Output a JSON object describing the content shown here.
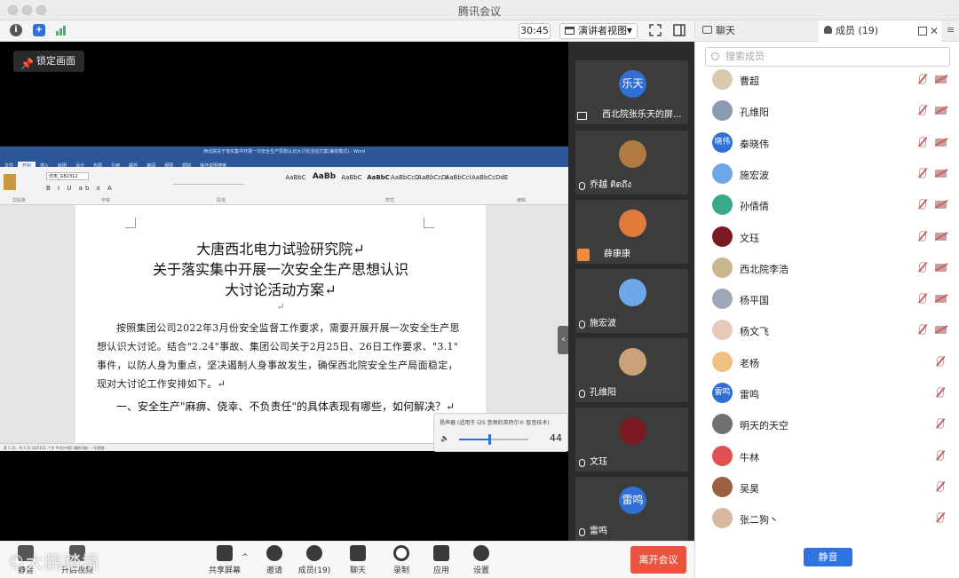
{
  "window": {
    "title": "腾讯会议"
  },
  "toolbar": {
    "timer": "30:45",
    "view_label": "演讲者视图",
    "colors": {
      "info": "#555555",
      "shield": "#2f6fd6",
      "signal": "#3dbb5e"
    }
  },
  "stage": {
    "lock_label": "锁定画面",
    "word": {
      "title_bar": "西北院关于落实集中开展一次安全生产思想认识大讨论活动方案(兼容模式) - Word",
      "tabs": [
        "文件",
        "开始",
        "插入",
        "绘图",
        "设计",
        "布局",
        "引用",
        "邮件",
        "审阅",
        "视图",
        "帮助",
        "操作说明搜索"
      ],
      "font_name": "仿宋_GB2312",
      "styles": [
        "AaBbC",
        "AaBb",
        "AaBbC",
        "AaBbC",
        "AaBbCcD",
        "AaBbCcDi",
        "AaBbCcI",
        "AaBbCcDdE"
      ],
      "groups": [
        "剪贴板",
        "字体",
        "段落",
        "样式",
        "编辑"
      ],
      "title_lines": [
        "大唐西北电力试验研究院↵",
        "关于落实集中开展一次安全生产思想认识",
        "大讨论活动方案↵"
      ],
      "return_mark": "↵",
      "paragraph": "按照集团公司2022年3月份安全监督工作要求，需要开展开展一次安全生产思想认识大讨论。结合\"2.24\"事故、集团公司关于2月25日、26日工作要求、\"3.1\" 事件，以防人身为重点，坚决遏制人身事故发生，确保西北院安全生产局面稳定，现对大讨论工作安排如下。↵",
      "subheading": "一、安全生产\"麻痹、侥幸、不负责任\"的具体表现有哪些，如何解决？↵",
      "status": "第 1 页，共 5 页    10/2161 个字    中文(中国)    辅助功能: 一切就绪"
    },
    "volume": {
      "label": "扬声器 (适用于 I2S 音频的英特尔® 智音技术)",
      "value": "44",
      "level": 0.44
    }
  },
  "videos": [
    {
      "name": "西北院张乐天的屏...",
      "avatar_text": "乐天",
      "avatar_color": "#2f6fd6",
      "kind": "screen"
    },
    {
      "name": "乔越 ติดถึง",
      "avatar_text": "",
      "avatar_color": "#b07a40",
      "kind": "mic"
    },
    {
      "name": "薛康康",
      "avatar_text": "",
      "avatar_color": "#e07a3a",
      "kind": "org"
    },
    {
      "name": "施宏波",
      "avatar_text": "",
      "avatar_color": "#6fa8e8",
      "kind": "mic"
    },
    {
      "name": "孔维阳",
      "avatar_text": "",
      "avatar_color": "#c9a27a",
      "kind": "mic"
    },
    {
      "name": "文珏",
      "avatar_text": "",
      "avatar_color": "#7a1a22",
      "kind": "mic"
    },
    {
      "name": "雷鸣",
      "avatar_text": "雷鸣",
      "avatar_color": "#2f6fd6",
      "kind": "mic"
    }
  ],
  "bottombar": {
    "items": [
      {
        "label": "静音"
      },
      {
        "label": "开启视频"
      },
      {
        "label": "共享屏幕"
      },
      {
        "label": "邀请"
      },
      {
        "label": "成员(19)"
      },
      {
        "label": "聊天"
      },
      {
        "label": "录制"
      },
      {
        "label": "应用"
      },
      {
        "label": "设置"
      }
    ],
    "leave_label": "离开会议",
    "watermark": "©大鹏踏境"
  },
  "panel": {
    "tabs": [
      {
        "label": "聊天"
      },
      {
        "label": "成员 (19)"
      }
    ],
    "search_placeholder": "搜索成员",
    "members": [
      {
        "name": "曹超",
        "avatar_text": "",
        "color": "#d9c9b0",
        "cam": true
      },
      {
        "name": "孔维阳",
        "avatar_text": "",
        "color": "#8a9bb0",
        "cam": true
      },
      {
        "name": "秦晓伟",
        "avatar_text": "晓伟",
        "color": "#2f6fd6",
        "cam": true
      },
      {
        "name": "施宏波",
        "avatar_text": "",
        "color": "#6fa8e8",
        "cam": true
      },
      {
        "name": "孙倩倩",
        "avatar_text": "",
        "color": "#3aa88a",
        "cam": true
      },
      {
        "name": "文珏",
        "avatar_text": "",
        "color": "#7a1a22",
        "cam": true
      },
      {
        "name": "西北院李浩",
        "avatar_text": "",
        "color": "#c8b890",
        "cam": true
      },
      {
        "name": "杨平国",
        "avatar_text": "",
        "color": "#a0a8b8",
        "cam": true
      },
      {
        "name": "杨文飞",
        "avatar_text": "",
        "color": "#e8c8b8",
        "cam": true
      },
      {
        "name": "老杨",
        "avatar_text": "",
        "color": "#f0c080",
        "cam": false
      },
      {
        "name": "雷鸣",
        "avatar_text": "雷鸣",
        "color": "#2f6fd6",
        "cam": false
      },
      {
        "name": "明天的天空",
        "avatar_text": "",
        "color": "#707070",
        "cam": false
      },
      {
        "name": "牛林",
        "avatar_text": "",
        "color": "#e05050",
        "cam": false
      },
      {
        "name": "吴昊",
        "avatar_text": "",
        "color": "#9a6040",
        "cam": false
      },
      {
        "name": "张二狗丶",
        "avatar_text": "",
        "color": "#d8b8a0",
        "cam": false
      }
    ],
    "mute_all_label": "静音"
  }
}
